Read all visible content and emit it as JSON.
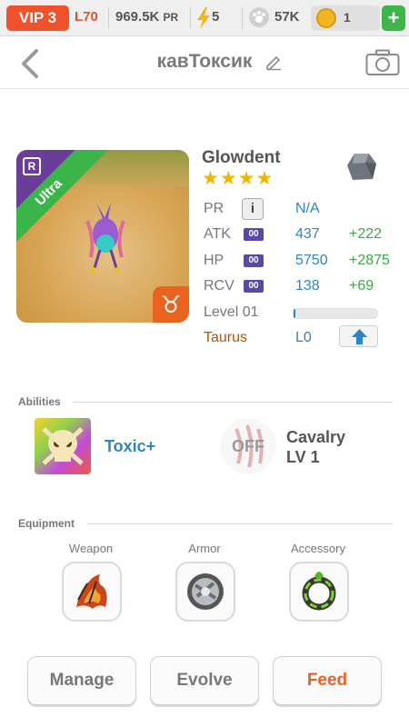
{
  "statusbar": {
    "vip": "VIP 3",
    "level": "L70",
    "pr_value": "969.5K",
    "pr_unit": "PR",
    "energy": "5",
    "pets": "57K",
    "coins": "1",
    "plus_label": "+"
  },
  "header": {
    "title": "кавТоксик"
  },
  "monster": {
    "name": "Glowdent",
    "stars": "★★★★",
    "rank_badge": "R",
    "tier": "Ultra",
    "zodiac_symbol": "♉",
    "stats": {
      "pr_label": "PR",
      "pr_info": "i",
      "pr_value": "N/A",
      "atk_label": "ATK",
      "atk_badge": "00",
      "atk_value": "437",
      "atk_bonus": "+222",
      "hp_label": "HP",
      "hp_badge": "00",
      "hp_value": "5750",
      "hp_bonus": "+2875",
      "rcv_label": "RCV",
      "rcv_badge": "00",
      "rcv_value": "138",
      "rcv_bonus": "+69"
    },
    "level_label": "Level 01",
    "level_progress": 0.02,
    "zodiac_name": "Taurus",
    "zodiac_level": "L0"
  },
  "abilities": {
    "header": "Abilities",
    "ability_name": "Toxic+",
    "off_label": "OFF",
    "cavalry_line1": "Cavalry",
    "cavalry_line2": "LV 1"
  },
  "equipment": {
    "header": "Equipment",
    "weapon_label": "Weapon",
    "armor_label": "Armor",
    "accessory_label": "Accessory"
  },
  "actions": {
    "manage": "Manage",
    "evolve": "Evolve",
    "feed": "Feed"
  },
  "colors": {
    "accent_blue": "#2f84c8",
    "bonus_green": "#39a845",
    "vip_red": "#f0522c",
    "feed_orange": "#e8622a",
    "ultra_green": "#3bb54a"
  }
}
